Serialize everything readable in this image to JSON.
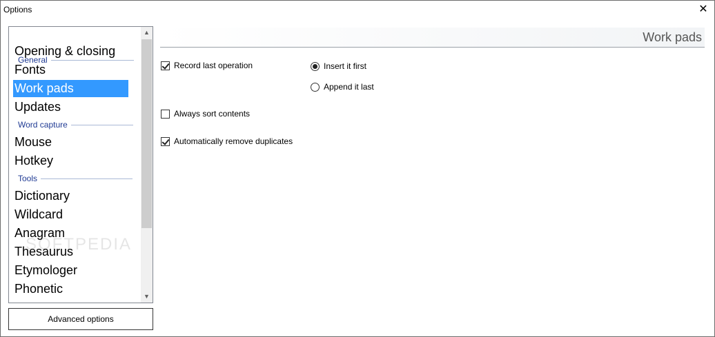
{
  "window": {
    "title": "Options",
    "close_glyph": "✕"
  },
  "nav": {
    "sections": [
      {
        "label": "General"
      },
      {
        "label": "Word capture"
      },
      {
        "label": "Tools"
      }
    ],
    "items": [
      {
        "label": "Opening & closing"
      },
      {
        "label": "Fonts"
      },
      {
        "label": "Work pads",
        "selected": true
      },
      {
        "label": "Updates"
      },
      {
        "label": "Mouse"
      },
      {
        "label": "Hotkey"
      },
      {
        "label": "Dictionary"
      },
      {
        "label": "Wildcard"
      },
      {
        "label": "Anagram"
      },
      {
        "label": "Thesaurus"
      },
      {
        "label": "Etymologer"
      },
      {
        "label": "Phonetic"
      }
    ],
    "scroll_up": "▲",
    "scroll_down": "▼"
  },
  "advanced_button": {
    "label": "Advanced options"
  },
  "panel": {
    "title": "Work pads",
    "options": {
      "record_last_operation": {
        "label": "Record last operation",
        "checked": true
      },
      "insert_first": {
        "label": "Insert it first",
        "selected": true
      },
      "append_last": {
        "label": "Append it last",
        "selected": false
      },
      "always_sort": {
        "label": "Always sort contents",
        "checked": false
      },
      "remove_duplicates": {
        "label": "Automatically remove duplicates",
        "checked": true
      }
    }
  },
  "watermark": "SOFTPEDIA"
}
